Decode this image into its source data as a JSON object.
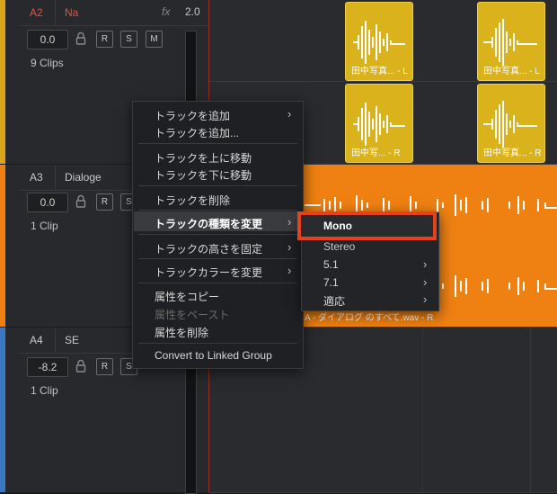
{
  "tracks": [
    {
      "id": "A2",
      "name": "Na",
      "fx": "fx",
      "channels": "2.0",
      "volume": "0.0",
      "clips": "9 Clips",
      "id_color": "#e0533f",
      "name_color": "#e0533f",
      "stripe_color": "#d9a51a"
    },
    {
      "id": "A3",
      "name": "Dialoge",
      "volume": "0.0",
      "clips": "1 Clip",
      "stripe_color": "#ee8112"
    },
    {
      "id": "A4",
      "name": "SE",
      "volume": "-8.2",
      "clips": "1 Clip",
      "stripe_color": "#3a78c4"
    }
  ],
  "track_buttons": {
    "r": "R",
    "s": "S",
    "m": "M"
  },
  "timeline": {
    "yellow_clips": [
      "田中写真... - L",
      "田中写真... - L",
      "田中写... - R",
      "田中写真... - R"
    ],
    "orange_clip_label": "A - ダイアログ のすべて.wav - R"
  },
  "context_menu": {
    "items": [
      {
        "label": "トラックを追加",
        "submenu": true
      },
      {
        "label": "トラックを追加..."
      },
      {
        "label": "トラックを上に移動"
      },
      {
        "label": "トラックを下に移動"
      },
      {
        "label": "トラックを削除"
      },
      {
        "label": "トラックの種類を変更",
        "submenu": true,
        "selected": true
      },
      {
        "label": "トラックの高さを固定",
        "submenu": true
      },
      {
        "label": "トラックカラーを変更",
        "submenu": true
      },
      {
        "label": "属性をコピー"
      },
      {
        "label": "属性をペースト",
        "disabled": true
      },
      {
        "label": "属性を削除"
      },
      {
        "label": "Convert to Linked Group"
      }
    ]
  },
  "submenu": {
    "items": [
      {
        "label": "Mono",
        "highlighted": true
      },
      {
        "label": "Stereo"
      },
      {
        "label": "5.1",
        "submenu": true
      },
      {
        "label": "7.1",
        "submenu": true
      },
      {
        "label": "適応",
        "submenu": true
      }
    ],
    "highlight_color": "#e8401c"
  },
  "icons": {
    "lock": "lock-icon",
    "chevron": "›"
  }
}
